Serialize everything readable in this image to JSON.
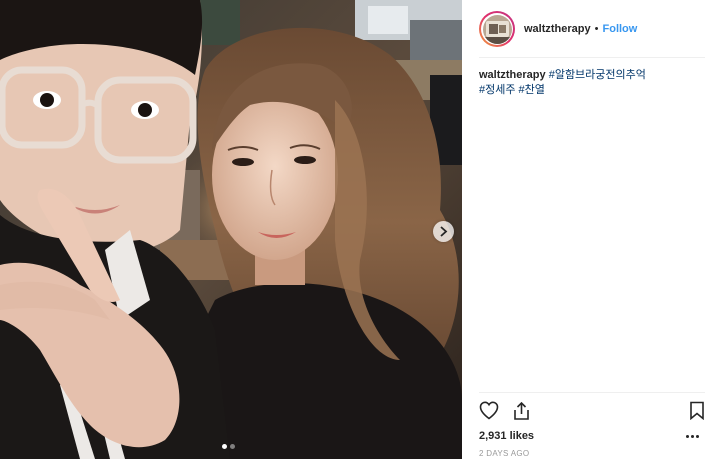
{
  "post": {
    "username": "waltztherapy",
    "separator": "•",
    "follow_label": "Follow",
    "caption": {
      "username": "waltztherapy",
      "hashtags": [
        "#알함브라궁전의추억",
        "#정세주",
        "#찬열"
      ]
    },
    "likes": "2,931 likes",
    "date": "2 DAYS AGO"
  },
  "carousel": {
    "slide_count": 2,
    "current_slide": 1
  },
  "colors": {
    "link": "#3897f0",
    "hashtag": "#003569",
    "text": "#262626",
    "muted": "#999999"
  },
  "icons": [
    "heart-icon",
    "share-icon",
    "bookmark-icon",
    "more-options-icon",
    "chevron-right-icon"
  ]
}
